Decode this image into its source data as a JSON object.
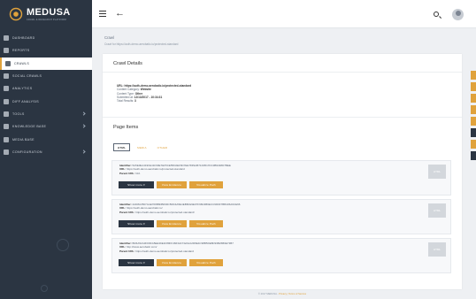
{
  "brand": {
    "name": "MEDUSA",
    "tagline": "CRAWL & RESEARCH PLATFORM"
  },
  "sidebar": {
    "items": [
      {
        "label": "DASHBOARD",
        "icon": "home-icon"
      },
      {
        "label": "REPORTS",
        "icon": "chart-icon"
      },
      {
        "label": "CRAWLS",
        "icon": "list-icon",
        "active": true
      },
      {
        "label": "SOCIAL CRAWLS",
        "icon": "share-icon"
      },
      {
        "label": "ANALYTICS",
        "icon": "search-icon"
      },
      {
        "label": "DIFF ANALYSIS",
        "icon": "edit-icon"
      },
      {
        "label": "TOOLS",
        "icon": "wrench-icon",
        "has_children": true
      },
      {
        "label": "KNOWLEDGE BASE",
        "icon": "book-icon",
        "has_children": true
      },
      {
        "label": "MEDIA BASE",
        "icon": "media-icon"
      },
      {
        "label": "CONFIGURATION",
        "icon": "gear-icon",
        "has_children": true
      }
    ]
  },
  "breadcrumb": {
    "title": "Crawl",
    "sub": "Crawl for https://auth-demo.aerobatic.io/protected-standard"
  },
  "crawl_details": {
    "heading": "Crawl Details",
    "url_label": "URL:",
    "url": "https://auth-demo.aerobatic.io/protected-standard",
    "category_label": "Content Category:",
    "category": "Website",
    "type_label": "Content Type:",
    "type": "Other",
    "submitted_label": "Submitted at:",
    "submitted": "12/13/2017 - 10:34:31",
    "total_label": "Total Results:",
    "total": "3"
  },
  "page_items": {
    "heading": "Page Items",
    "filters": [
      "HTML",
      "MEDIA",
      "OTHER"
    ],
    "identifier_label": "Identifier:",
    "url_label": "URL:",
    "parent_label": "Parent URL:",
    "buttons": {
      "show_more": "Show more ▾",
      "view_evidence": "View Evidence",
      "visualize_path": "Visualize Path"
    },
    "thumb_label": "HTML",
    "items": [
      {
        "identifier": "5A5E0E1419FE41F60E7EF5CE55D2EF6D7EE78F9AB71D0517DC3B9348D7BEE",
        "url": "https://auth-demo.aerobatic.io/protected-standard",
        "parent": "N/A"
      },
      {
        "identifier": "2AD8A3507AAE709B6DB099C5DD4A5E4EB6FE9E07F96D4B6ECC99DF7BB436A6CE66",
        "url": "https://auth-demo.aerobatic.io/",
        "parent": "https://auth-demo.aerobatic.io/protected-standard/"
      },
      {
        "identifier": "BD6A52A3FD6FA5EE39E1F89FF46634A732A2A2D8E4C98B5DE8D93B26B6E73B7",
        "url": "http://www.aerobatic.com/",
        "parent": "https://auth-demo.aerobatic.io/protected-standard"
      }
    ]
  },
  "footer": {
    "prefix": "© 2017 MEDUSA - ",
    "link": "Privacy | Terms of Service"
  },
  "colors": {
    "sidebar": "#2b3542",
    "accent": "#e0a23c"
  }
}
